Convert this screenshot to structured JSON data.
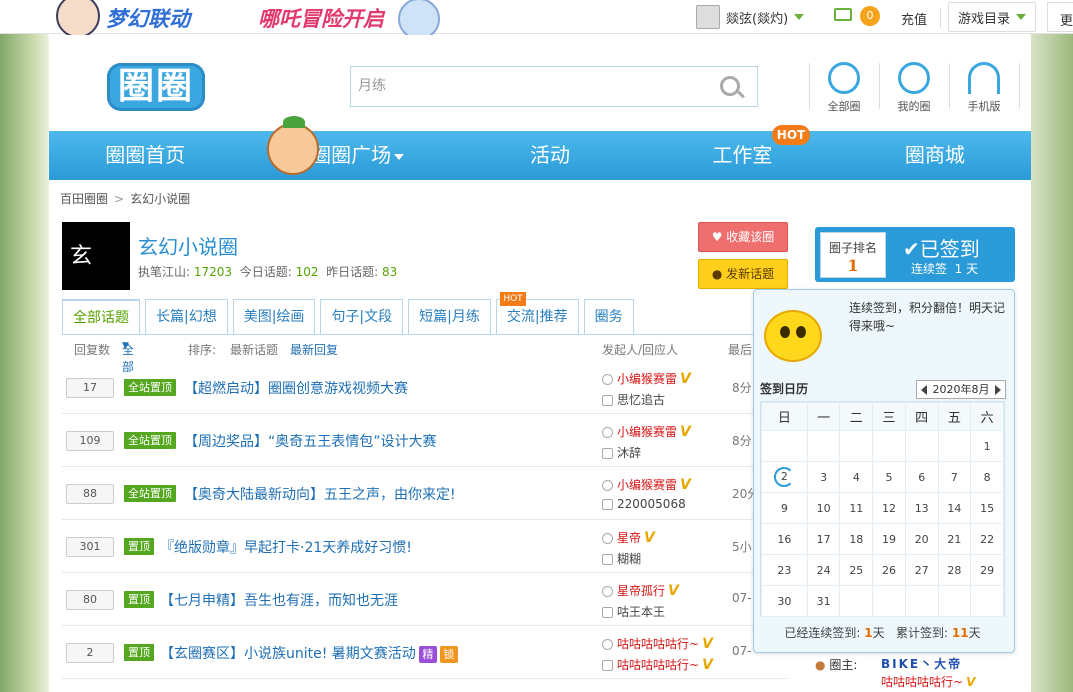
{
  "topbar": {
    "banner_left": "梦幻联动",
    "banner_right": "哪吒冒险开启",
    "username": "燚弦(燚灼)",
    "mail_count": "0",
    "recharge": "充值",
    "game_dir": "游戏目录",
    "more": "更"
  },
  "header": {
    "logo": "圈圈",
    "search_placeholder": "月练",
    "nav_icons": [
      {
        "label": "全部圈",
        "icon": "refresh-circle-icon"
      },
      {
        "label": "我的圈",
        "icon": "user-icon"
      },
      {
        "label": "手机版",
        "icon": "wifi-icon"
      }
    ]
  },
  "nav": {
    "items": [
      "圈圈首页",
      "圈圈广场",
      "活动",
      "工作室",
      "圈商城"
    ],
    "hot": "HOT"
  },
  "breadcrumb": {
    "root": "百田圈圈",
    "sep": ">",
    "current": "玄幻小说圈"
  },
  "circle": {
    "logo_text": "玄",
    "name": "玄幻小说圈",
    "label_author": "执笔江山:",
    "authors": "17203",
    "label_today": "今日话题:",
    "today": "102",
    "label_yesterday": "昨日话题:",
    "yesterday": "83",
    "fav_button": "收藏该圈",
    "post_button": "发新话题"
  },
  "tabs": [
    "全部话题",
    "长篇|幻想",
    "美图|绘画",
    "句子|文段",
    "短篇|月练",
    "交流|推荐",
    "圈务"
  ],
  "tab_hot": "HOT",
  "list_header": {
    "replies": "回复数",
    "filter": "全部",
    "sort_label": "排序:",
    "sort_newest": "最新话题",
    "sort_reply": "最新回复",
    "author": "发起人/回应人",
    "last": "最后"
  },
  "rows": [
    {
      "count": "17",
      "tag": "全站置顶",
      "title": "【超燃启动】圈圈创意游戏视频大赛",
      "author": "小编猴赛雷",
      "replier": "思忆追古",
      "time": "8分"
    },
    {
      "count": "109",
      "tag": "全站置顶",
      "title": "【周边奖品】“奥奇五王表情包”设计大赛",
      "author": "小编猴赛雷",
      "replier": "沐辞",
      "time": "8分"
    },
    {
      "count": "88",
      "tag": "全站置顶",
      "title": "【奥奇大陆最新动向】五王之声，由你来定!",
      "author": "小编猴赛雷",
      "replier": "220005068",
      "time": "20分"
    },
    {
      "count": "301",
      "tag": "置顶",
      "title": "『绝版勋章』早起打卡·21天养成好习惯!",
      "author": "星帝",
      "replier": "糊糊",
      "time": "5小"
    },
    {
      "count": "80",
      "tag": "置顶",
      "title": "【七月申精】吾生也有涯，而知也无涯",
      "author": "星帝孤行",
      "replier": "咕王本王",
      "time": "07-"
    },
    {
      "count": "2",
      "tag": "置顶",
      "title": "【玄圈赛区】小说族unite! 暑期文赛活动",
      "author": "咕咕咕咕咕行~",
      "replier": "咕咕咕咕咕行~",
      "time": "07-",
      "badges": [
        "精",
        "锁"
      ]
    }
  ],
  "signin": {
    "rank_label": "圈子排名",
    "rank_value": "1",
    "signed": "已签到",
    "continuous": "连续签",
    "continuous_days": "1 天",
    "message": "连续签到，积分翻倍！明天记得来哦~",
    "calendar_title": "签到日历",
    "month": "2020年8月",
    "weekdays": [
      "日",
      "一",
      "二",
      "三",
      "四",
      "五",
      "六"
    ],
    "weeks": [
      [
        "",
        "",
        "",
        "",
        "",
        "",
        "1"
      ],
      [
        "2",
        "3",
        "4",
        "5",
        "6",
        "7",
        "8"
      ],
      [
        "9",
        "10",
        "11",
        "12",
        "13",
        "14",
        "15"
      ],
      [
        "16",
        "17",
        "18",
        "19",
        "20",
        "21",
        "22"
      ],
      [
        "23",
        "24",
        "25",
        "26",
        "27",
        "28",
        "29"
      ],
      [
        "30",
        "31",
        "",
        "",
        "",
        "",
        ""
      ]
    ],
    "today": "2",
    "foot_continuous_label": "已经连续签到:",
    "foot_continuous": "1",
    "foot_total_label": "累计签到:",
    "foot_total": "11",
    "day_unit": "天"
  },
  "owner": {
    "label": "圈主:",
    "name1": "BIKE丶大帝",
    "name2": "咕咕咕咕咕行~"
  },
  "colors": {
    "brand_blue": "#2a9bd8",
    "green": "#55a300",
    "red": "#d61414",
    "orange": "#f47b16"
  }
}
